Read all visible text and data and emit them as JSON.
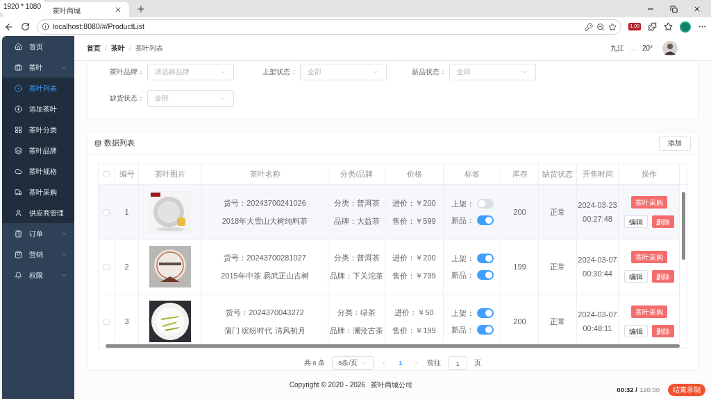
{
  "browser": {
    "tab_title": "茶叶商城",
    "url": "localhost:8080/#/ProductList",
    "badge": "1.00"
  },
  "overlay": {
    "resolution": "1920 * 1080"
  },
  "sidebar": {
    "items": [
      {
        "kind": "link",
        "label": "首页",
        "selected": false
      },
      {
        "kind": "group",
        "label": "茶叶",
        "selected": false,
        "expanded": true,
        "children": [
          {
            "label": "茶叶列表",
            "selected": true
          },
          {
            "label": "添加茶叶",
            "selected": false
          },
          {
            "label": "茶叶分类",
            "selected": false
          },
          {
            "label": "茶叶品牌",
            "selected": false
          },
          {
            "label": "茶叶规格",
            "selected": false
          },
          {
            "label": "茶叶采购",
            "selected": false
          },
          {
            "label": "供应商管理",
            "selected": false
          }
        ]
      },
      {
        "kind": "group",
        "label": "订单",
        "selected": false,
        "expanded": false
      },
      {
        "kind": "group",
        "label": "营销",
        "selected": false,
        "expanded": false
      },
      {
        "kind": "group",
        "label": "权限",
        "selected": false,
        "expanded": false
      }
    ]
  },
  "header": {
    "breadcrumb": [
      "首页",
      "茶叶",
      "茶叶列表"
    ],
    "separator": "/",
    "city": "九江",
    "weather": "…",
    "temperature": "20°"
  },
  "filters": [
    {
      "label": "茶叶品牌：",
      "placeholder": "请选择品牌"
    },
    {
      "label": "上架状态：",
      "placeholder": "全部"
    },
    {
      "label": "新品状态：",
      "placeholder": "全部"
    },
    {
      "label": "缺货状态：",
      "placeholder": "全部"
    }
  ],
  "list": {
    "title": "数据列表",
    "add_button": "添加",
    "select_all_checked": false,
    "columns": [
      "编号",
      "茶叶图片",
      "茶叶名称",
      "分类/品牌",
      "价格",
      "标签",
      "库存",
      "缺货状态",
      "开售时间",
      "操作"
    ],
    "rows": [
      {
        "checked": false,
        "id": "1",
        "sku": "货号：20243700241026",
        "name": "2018年大雪山大树纯料茶",
        "category": "分类：普洱茶",
        "brand": "品牌：大益茶",
        "cost": "进价：￥200",
        "price": "售价：￥599",
        "on_shelf": {
          "label": "上架：",
          "on": false
        },
        "is_new": {
          "label": "新品：",
          "on": true
        },
        "stock": "200",
        "status": "正常",
        "date": "2024-03-23",
        "time": "00:27:48",
        "purchase": "茶叶采购",
        "edit": "编辑",
        "delete": "删除"
      },
      {
        "checked": false,
        "id": "2",
        "sku": "货号：20243700281027",
        "name": "2015年中茶 易武正山古树",
        "category": "分类：普洱茶",
        "brand": "品牌：下关沱茶",
        "cost": "进价：￥200",
        "price": "售价：￥799",
        "on_shelf": {
          "label": "上架：",
          "on": true
        },
        "is_new": {
          "label": "新品：",
          "on": true
        },
        "stock": "199",
        "status": "正常",
        "date": "2024-03-07",
        "time": "00:30:44",
        "purchase": "茶叶采购",
        "edit": "编辑",
        "delete": "删除"
      },
      {
        "checked": false,
        "id": "3",
        "sku": "货号：2024370043272",
        "name": "蒲门 缤纷时代 清风初月",
        "category": "分类：绿茶",
        "brand": "品牌：澜沧古茶",
        "cost": "进价：￥50",
        "price": "售价：￥199",
        "on_shelf": {
          "label": "上架：",
          "on": true
        },
        "is_new": {
          "label": "新品：",
          "on": true
        },
        "stock": "200",
        "status": "正常",
        "date": "2024-03-07",
        "time": "00:48:11",
        "purchase": "茶叶采购",
        "edit": "编辑",
        "delete": "删除"
      }
    ]
  },
  "pagination": {
    "total": "共 6 条",
    "page_size": "6条/页",
    "pages": [
      {
        "label": "1",
        "selected": true
      }
    ],
    "goto_label": "前往",
    "goto_value": "1",
    "goto_suffix": "页"
  },
  "footer": "Copyright © 2020 - 2026   茶叶商城公司",
  "recorder": {
    "elapsed": "00:32 /",
    "limit": "120:00",
    "stop": "结束录制"
  }
}
